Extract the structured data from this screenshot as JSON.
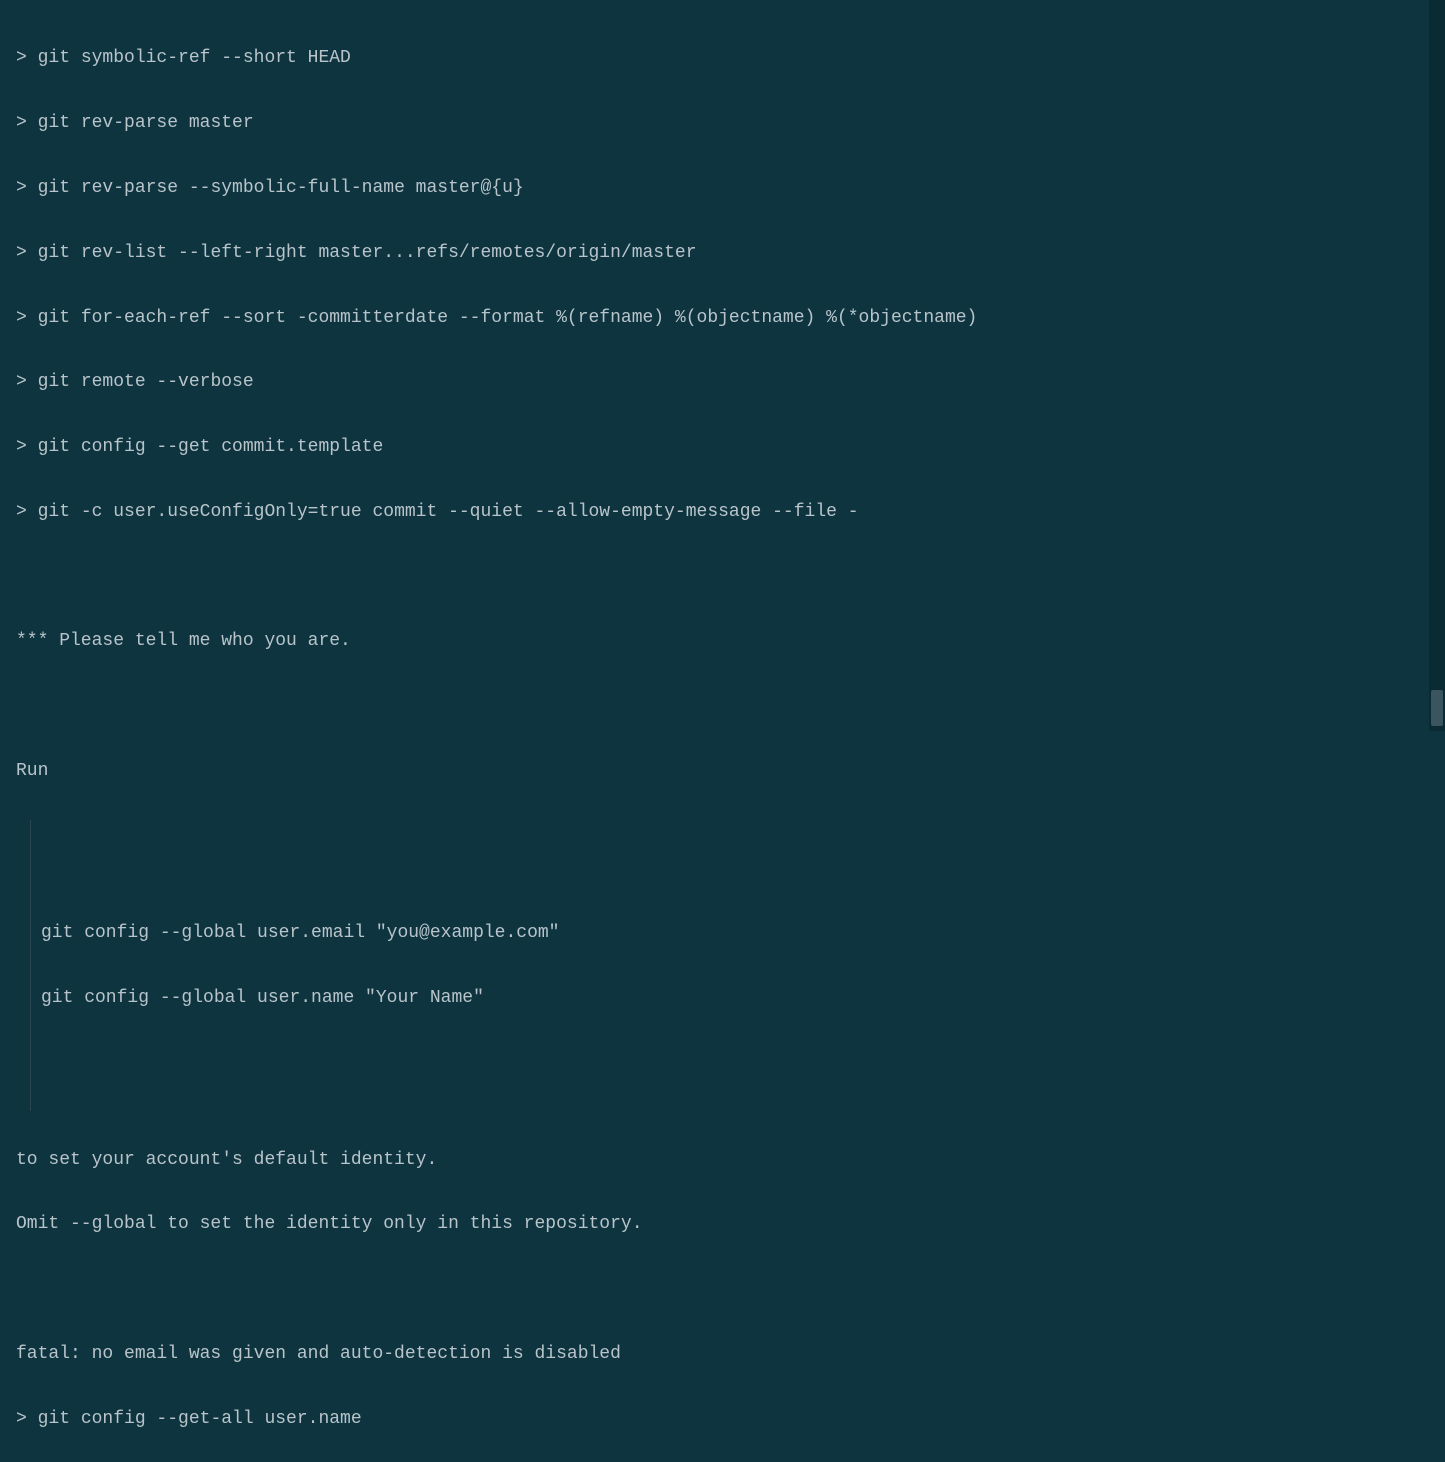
{
  "prompt": "> ",
  "lines": {
    "l0": "> g",
    "l1": "git symbolic-ref --short HEAD",
    "l2": "git rev-parse master",
    "l3": "git rev-parse --symbolic-full-name master@{u}",
    "l4": "git rev-list --left-right master...refs/remotes/origin/master",
    "l5": "git for-each-ref --sort -committerdate --format %(refname) %(objectname) %(*objectname)",
    "l6": "git remote --verbose",
    "l7": "git config --get commit.template",
    "l8": "git -c user.useConfigOnly=true commit --quiet --allow-empty-message --file -",
    "msg_header": "*** Please tell me who you are.",
    "msg_run": "Run",
    "msg_cfg_email": "git config --global user.email \"you@example.com\"",
    "msg_cfg_name": "git config --global user.name \"Your Name\"",
    "msg_set": "to set your account's default identity.",
    "msg_omit": "Omit --global to set the identity only in this repository.",
    "msg_fatal": "fatal: no email was given and auto-detection is disabled",
    "l9": "git config --get-all user.name"
  }
}
